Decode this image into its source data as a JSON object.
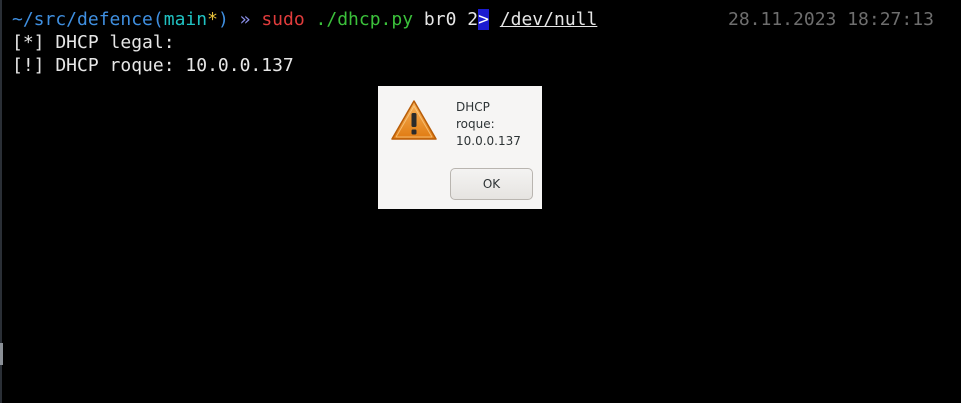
{
  "terminal": {
    "prompt": {
      "path": "~/src/defence",
      "paren_open": "(",
      "branch": "main",
      "dirty_mark": "*",
      "paren_close": ")",
      "symbol": "»",
      "command": "sudo",
      "script": "./dhcp.py",
      "arg": "br0",
      "fd": "2",
      "redirect": ">",
      "target": "/dev/null"
    },
    "timestamp": "28.11.2023 18:27:13",
    "output": [
      "[*] DHCP legal:",
      "[!] DHCP roque: 10.0.0.137"
    ]
  },
  "dialog": {
    "icon": "warning-icon",
    "message": "DHCP\nroque:\n10.0.0.137",
    "ok_label": "OK"
  },
  "colors": {
    "background": "#000000",
    "path": "#3f8fe0",
    "branch": "#20c2c2",
    "dirty": "#e8c23a",
    "command": "#e03c3c",
    "script": "#3bc03b",
    "redirect_highlight": "#1b1bd0",
    "timestamp": "#6e6e6e",
    "warning_orange": "#f0921a"
  }
}
